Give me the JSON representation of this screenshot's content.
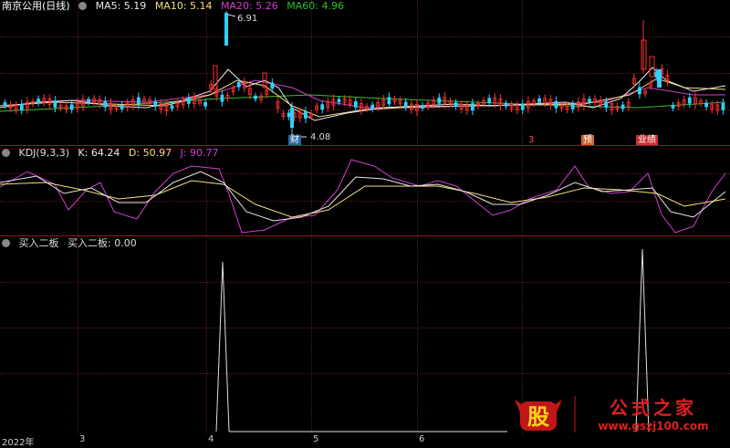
{
  "main_pane": {
    "title": "南京公用(日线)",
    "ma5": "MA5: 5.19",
    "ma10": "MA10: 5.14",
    "ma20": "MA20: 5.26",
    "ma60": "MA60: 4.96",
    "high_label": "6.91",
    "low_label": "4.08",
    "events": [
      "财",
      "3",
      "预",
      "业绩"
    ]
  },
  "kdj_pane": {
    "title": "KDJ(9,3,3)",
    "k": "K: 64.24",
    "d": "D: 50.97",
    "j": "J: 90.77"
  },
  "signal_pane": {
    "title": "买入二板",
    "series_label": "买入二板: 0.00"
  },
  "x_axis": [
    "2022年",
    "3",
    "4",
    "5",
    "6"
  ],
  "watermark": {
    "glyph": "股",
    "brand": "公式之家",
    "url": "www.gszj100.com"
  },
  "colors": {
    "ma5": "#e8e8e8",
    "ma10": "#f4e07a",
    "ma20": "#d040d0",
    "ma60": "#2ec02e",
    "up": "#ff3030",
    "down": "#30d0ff",
    "sep": "#8a1c1c"
  },
  "chart_data": [
    {
      "type": "candlestick",
      "title": "南京公用(日线)",
      "series": [
        {
          "name": "MA5",
          "value": 5.19
        },
        {
          "name": "MA10",
          "value": 5.14
        },
        {
          "name": "MA20",
          "value": 5.26
        },
        {
          "name": "MA60",
          "value": 4.96
        }
      ],
      "annotations": [
        {
          "text": "6.91",
          "kind": "high"
        },
        {
          "text": "4.08",
          "kind": "low"
        }
      ]
    },
    {
      "type": "line",
      "title": "KDJ(9,3,3)",
      "series": [
        {
          "name": "K",
          "value": 64.24
        },
        {
          "name": "D",
          "value": 50.97
        },
        {
          "name": "J",
          "value": 90.77
        }
      ]
    },
    {
      "type": "line",
      "title": "买入二板",
      "series": [
        {
          "name": "买入二板",
          "value": 0.0
        }
      ],
      "spikes": [
        "4",
        "6"
      ]
    }
  ]
}
